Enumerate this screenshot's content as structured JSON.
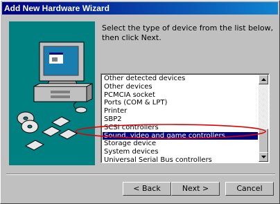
{
  "window": {
    "title": "Add New Hardware Wizard"
  },
  "instructions": "Select the type of device from the list below, then click Next.",
  "device_list": {
    "items": [
      "Other detected devices",
      "Other devices",
      "PCMCIA socket",
      "Ports (COM & LPT)",
      "Printer",
      "SBP2",
      "SCSI controllers",
      "Sound, video and game controllers",
      "Storage device",
      "System devices",
      "Universal Serial Bus controllers"
    ],
    "selected": "Sound, video and game controllers",
    "highlight_color": "#000080"
  },
  "annotation": {
    "color": "#e00000",
    "shape": "ellipse around selected item"
  },
  "buttons": {
    "back": "< Back",
    "next": "Next >",
    "cancel": "Cancel"
  },
  "icons": [
    "computer-icon",
    "cd-disc-icon",
    "floppy-disk-icon",
    "scroll-up-arrow-icon",
    "scroll-down-arrow-icon"
  ]
}
